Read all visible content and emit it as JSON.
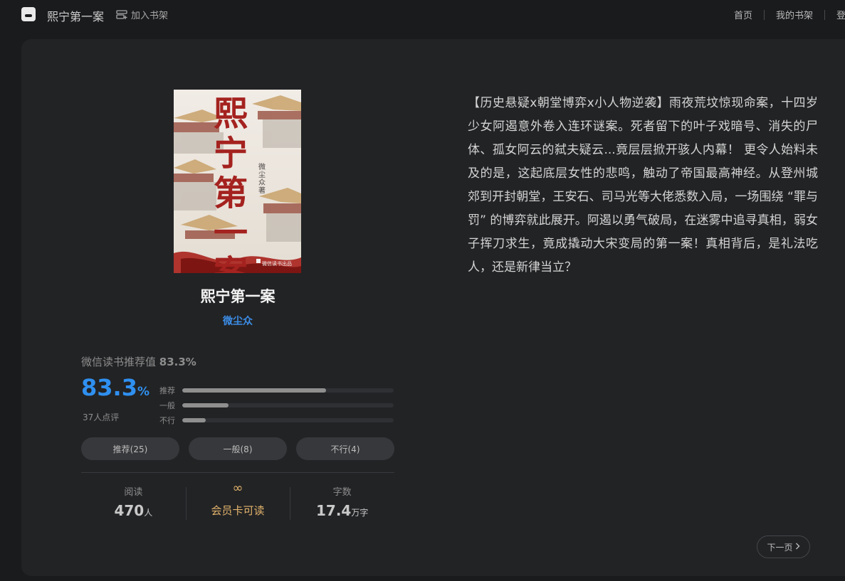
{
  "header": {
    "app_title": "熙宁第一案",
    "add_to_shelf": "加入书架",
    "nav": [
      "首页",
      "我的书架",
      "登"
    ]
  },
  "cover": {
    "title": "熙宁第一案",
    "author_tag": "微尘众 著",
    "publisher": "微信读书出品",
    "accent_color": "#a4221f"
  },
  "book": {
    "title": "熙宁第一案",
    "author": "微尘众",
    "description": "【历史悬疑x朝堂博弈x小人物逆袭】雨夜荒坟惊现命案，十四岁少女阿遏意外卷入连环谜案。死者留下的叶子戏暗号、消失的尸体、孤女阿云的弑夫疑云...竟层层掀开骇人内幕！ 更令人始料未及的是，这起底层女性的悲鸣，触动了帝国最高神经。从登州城郊到开封朝堂，王安石、司马光等大佬悉数入局，一场围绕 “罪与罚” 的博弈就此展开。阿遏以勇气破局，在迷雾中追寻真相，弱女子挥刀求生，竟成撬动大宋变局的第一案！真相背后，是礼法吃人，还是新律当立？"
  },
  "rating": {
    "label": "微信读书推荐值",
    "label_value": "83.3%",
    "value": "83.3",
    "percent_sign": "%",
    "count": "37人点评",
    "accent_color": "#2f90f0",
    "bars": [
      {
        "label": "推荐",
        "fraction": 0.68
      },
      {
        "label": "一般",
        "fraction": 0.22
      },
      {
        "label": "不行",
        "fraction": 0.11
      }
    ],
    "buttons": [
      "推荐(25)",
      "一般(8)",
      "不行(4)"
    ]
  },
  "stats": {
    "reads_label": "阅读",
    "reads_value": "470",
    "reads_unit": "人",
    "member_icon": "∞",
    "member_text": "会员卡可读",
    "member_color": "#e2b36b",
    "words_label": "字数",
    "words_value": "17.4",
    "words_unit": "万字"
  },
  "pager": {
    "next_label": "下一页",
    "next_icon": "chevron-right-icon"
  }
}
